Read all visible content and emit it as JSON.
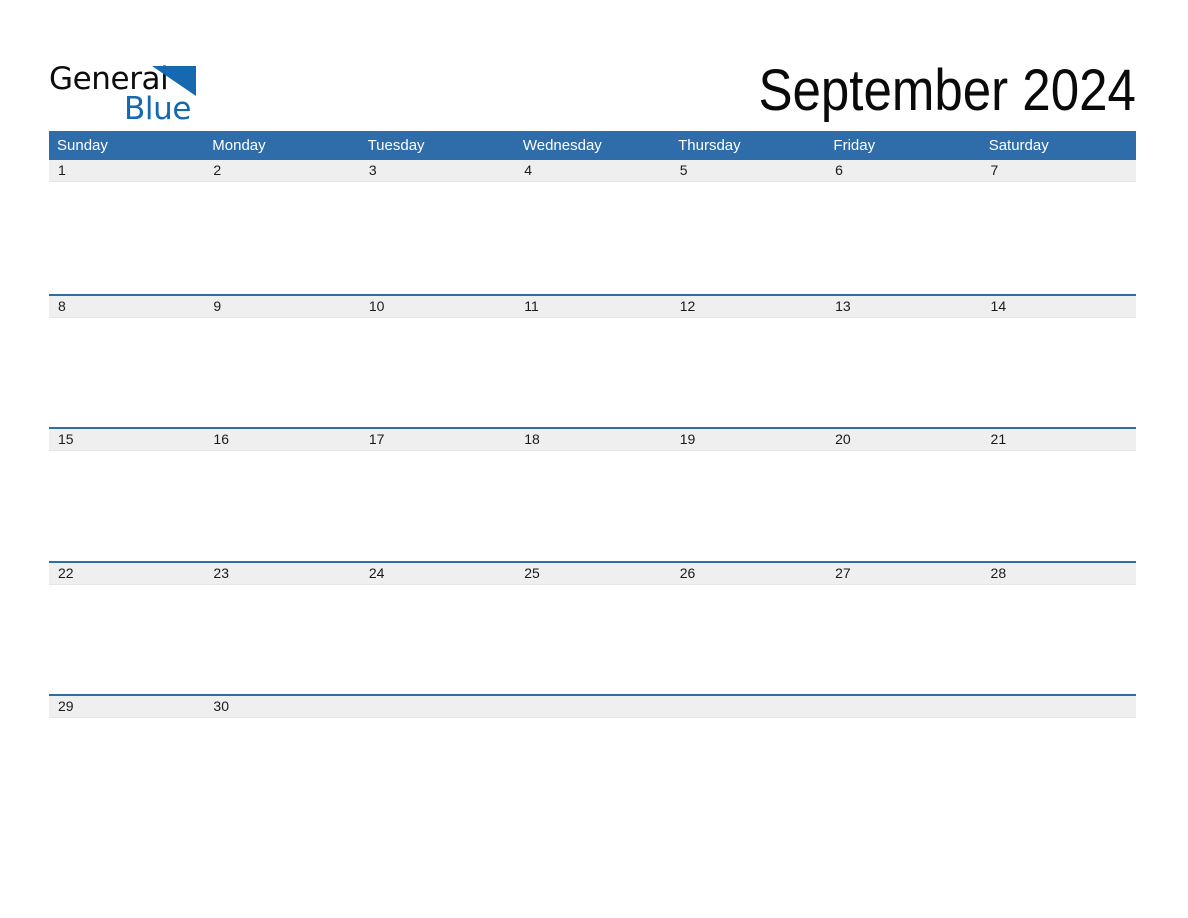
{
  "brand": {
    "name_part1": "General",
    "name_part2": "Blue",
    "logo_icon": "triangle-flag-icon",
    "blue_hex": "#1469b0"
  },
  "header": {
    "title": "September 2024",
    "month": "September",
    "year": "2024"
  },
  "theme": {
    "header_bar_hex": "#2e6da9",
    "date_band_hex": "#efefef",
    "row_divider_hex": "#2e6da9",
    "text_hex": "#1a1a1a",
    "page_bg_hex": "#ffffff"
  },
  "calendar": {
    "weekdays": [
      "Sunday",
      "Monday",
      "Tuesday",
      "Wednesday",
      "Thursday",
      "Friday",
      "Saturday"
    ],
    "weeks": [
      {
        "days": [
          "1",
          "2",
          "3",
          "4",
          "5",
          "6",
          "7"
        ]
      },
      {
        "days": [
          "8",
          "9",
          "10",
          "11",
          "12",
          "13",
          "14"
        ]
      },
      {
        "days": [
          "15",
          "16",
          "17",
          "18",
          "19",
          "20",
          "21"
        ]
      },
      {
        "days": [
          "22",
          "23",
          "24",
          "25",
          "26",
          "27",
          "28"
        ]
      },
      {
        "days": [
          "29",
          "30",
          "",
          "",
          "",
          "",
          ""
        ]
      }
    ]
  }
}
